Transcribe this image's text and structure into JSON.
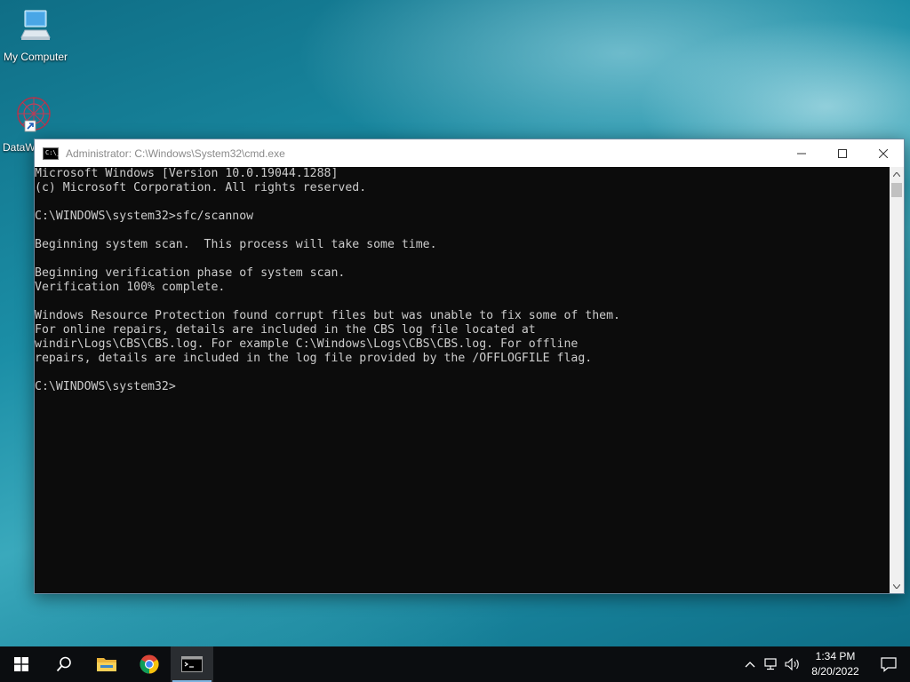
{
  "desktop": {
    "icons": [
      {
        "label": "My Computer"
      },
      {
        "label": "DataW"
      }
    ]
  },
  "window": {
    "title": "Administrator: C:\\Windows\\System32\\cmd.exe",
    "icon_text": "C:\\_",
    "console_output": "Microsoft Windows [Version 10.0.19044.1288]\n(c) Microsoft Corporation. All rights reserved.\n\nC:\\WINDOWS\\system32>sfc/scannow\n\nBeginning system scan.  This process will take some time.\n\nBeginning verification phase of system scan.\nVerification 100% complete.\n\nWindows Resource Protection found corrupt files but was unable to fix some of them.\nFor online repairs, details are included in the CBS log file located at\nwindir\\Logs\\CBS\\CBS.log. For example C:\\Windows\\Logs\\CBS\\CBS.log. For offline\nrepairs, details are included in the log file provided by the /OFFLOGFILE flag.\n\nC:\\WINDOWS\\system32>"
  },
  "taskbar": {
    "pinned": [
      "start-icon",
      "search-icon",
      "file-explorer-icon",
      "chrome-icon",
      "cmd-icon"
    ],
    "active": "cmd-icon",
    "clock": {
      "time": "1:34 PM",
      "date": "8/20/2022"
    }
  },
  "colors": {
    "console_bg": "#0c0c0c",
    "console_text": "#cccccc",
    "taskbar_bg": "#0b0d10",
    "accent": "#7fb4e0"
  }
}
